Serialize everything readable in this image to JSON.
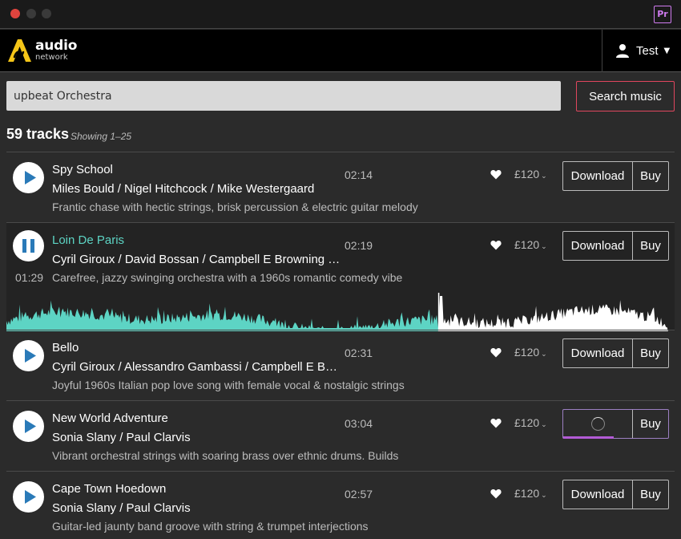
{
  "app": {
    "brand_line1": "audio",
    "brand_line2": "network",
    "badge": "Pr",
    "user_name": "Test"
  },
  "colors": {
    "accent": "#5dd4c4",
    "search_border": "#e0465e",
    "progress": "#b35bd6",
    "play_icon": "#2a7ab8"
  },
  "search": {
    "value": "upbeat Orchestra",
    "button_label": "Search music"
  },
  "results": {
    "count": "59 tracks",
    "showing": "Showing 1–25"
  },
  "tracks": [
    {
      "title": "Spy School",
      "artists": "Miles Bould / Nigel Hitchcock / Mike Westergaard",
      "description": "Frantic chase with hectic strings, brisk percussion & electric guitar melody",
      "duration": "02:14",
      "price": "£120",
      "download_label": "Download",
      "buy_label": "Buy",
      "state": "idle"
    },
    {
      "title": "Loin De Paris",
      "artists": "Cyril Giroux / David Bossan / Campbell E Browning / Pa...",
      "description": "Carefree, jazzy swinging orchestra with a 1960s romantic comedy vibe",
      "duration": "02:19",
      "elapsed": "01:29",
      "playback_progress": 0.647,
      "price": "£120",
      "download_label": "Download",
      "buy_label": "Buy",
      "state": "playing"
    },
    {
      "title": "Bello",
      "artists": "Cyril Giroux / Alessandro Gambassi / Campbell E Brow...",
      "description": "Joyful 1960s Italian pop love song with female vocal & nostalgic strings",
      "duration": "02:31",
      "price": "£120",
      "download_label": "Download",
      "buy_label": "Buy",
      "state": "idle"
    },
    {
      "title": "New World Adventure",
      "artists": "Sonia Slany / Paul Clarvis",
      "description": "Vibrant orchestral strings with soaring brass over ethnic drums. Builds",
      "duration": "03:04",
      "price": "£120",
      "buy_label": "Buy",
      "download_progress": 0.72,
      "state": "downloading"
    },
    {
      "title": "Cape Town Hoedown",
      "artists": "Sonia Slany / Paul Clarvis",
      "description": "Guitar-led jaunty band groove with string & trumpet interjections",
      "duration": "02:57",
      "price": "£120",
      "download_label": "Download",
      "buy_label": "Buy",
      "state": "idle"
    }
  ]
}
